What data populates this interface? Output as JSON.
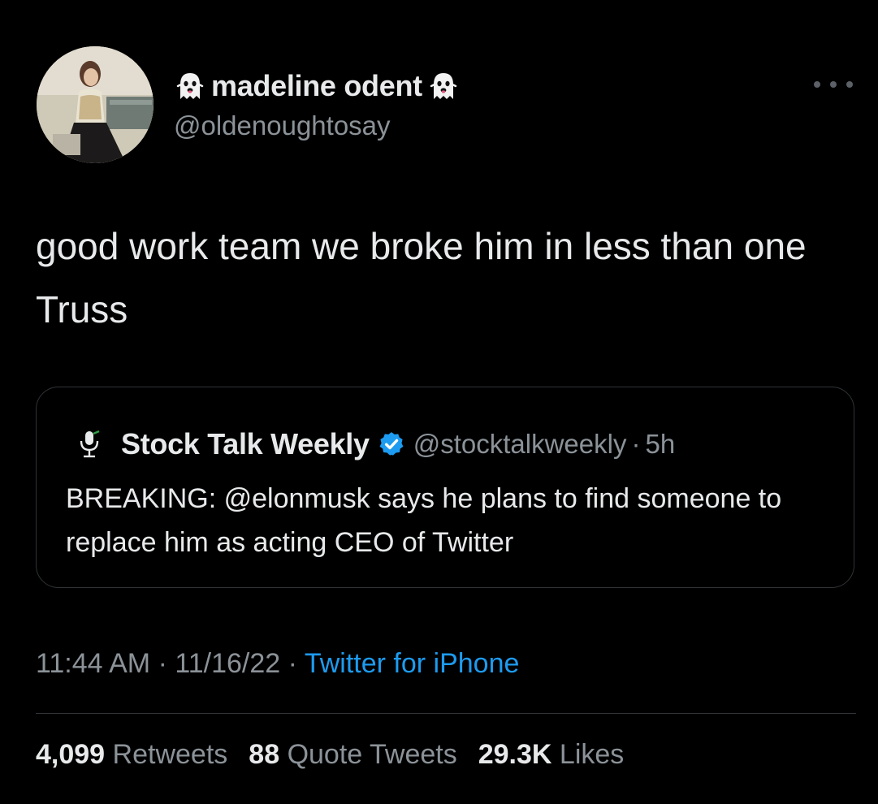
{
  "author": {
    "display_name": "madeline odent",
    "handle": "@oldenoughtosay",
    "name_emoji_left": "ghost-icon",
    "name_emoji_right": "ghost-icon"
  },
  "tweet": {
    "text": "good work team we broke him in less than one Truss"
  },
  "quote": {
    "name": "Stock Talk Weekly",
    "handle": "@stocktalkweekly",
    "separator": "·",
    "time": "5h",
    "text": "BREAKING: @elonmusk says he plans to find someone to replace him as acting CEO of Twitter",
    "avatar_icon": "microphone-icon",
    "badge_icon": "verified-badge-icon"
  },
  "meta": {
    "time": "11:44 AM",
    "date": "11/16/22",
    "separator": "·",
    "source": "Twitter for iPhone"
  },
  "stats": {
    "retweets_count": "4,099",
    "retweets_label": "Retweets",
    "quotes_count": "88",
    "quotes_label": "Quote Tweets",
    "likes_count": "29.3K",
    "likes_label": "Likes"
  },
  "colors": {
    "background": "#000000",
    "text_primary": "#e7e9ea",
    "text_secondary": "#8b9298",
    "link": "#1d9bf0",
    "border": "#2f3336",
    "verified": "#1d9bf0"
  }
}
